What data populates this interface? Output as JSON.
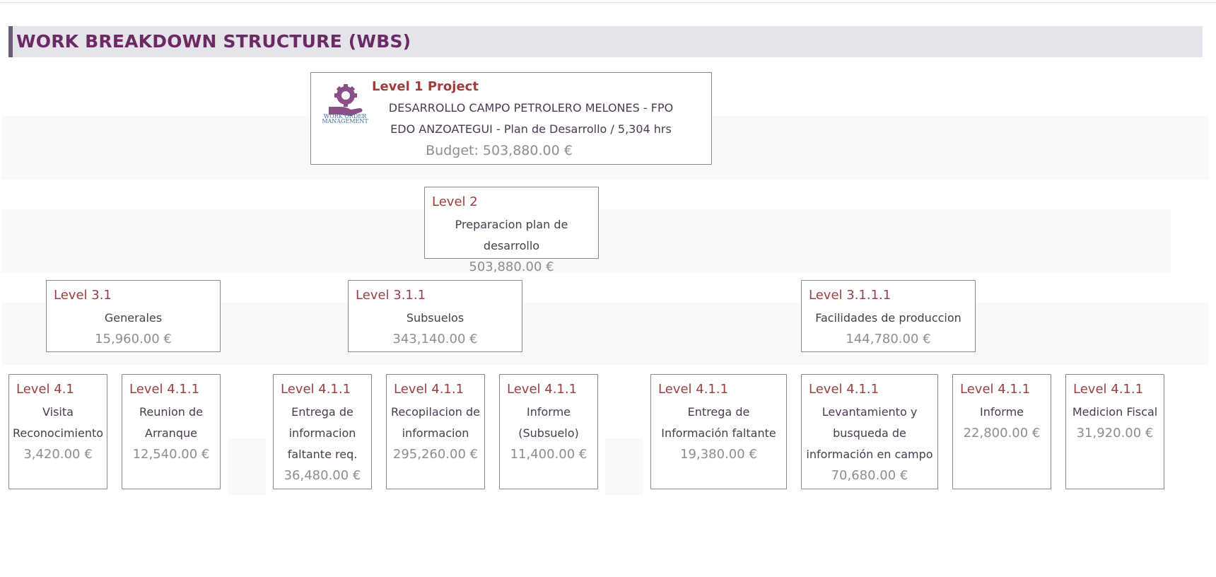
{
  "page": {
    "title": "WORK BREAKDOWN STRUCTURE (WBS)"
  },
  "logo": {
    "line1": "WORK ORDER",
    "line2": "MANAGEMENT",
    "icon": "hand-gear-icon"
  },
  "colors": {
    "level_label": "#9a4040",
    "title": "#6b2a63",
    "value": "#8e8e8e",
    "header_bg": "#e4e4ea"
  },
  "root": {
    "level": "Level 1 Project",
    "name": "DESARROLLO CAMPO PETROLERO MELONES - FPO EDO ANZOATEGUI - Plan de Desarrollo / 5,304 hrs",
    "budget": "Budget: 503,880.00 €"
  },
  "level2": {
    "level": "Level 2",
    "name": "Preparacion plan de desarrollo",
    "value": "503,880.00 €"
  },
  "level3": [
    {
      "level": "Level 3.1",
      "name": "Generales",
      "value": "15,960.00 €"
    },
    {
      "level": "Level 3.1.1",
      "name": "Subsuelos",
      "value": "343,140.00 €"
    },
    {
      "level": "Level 3.1.1.1",
      "name": "Facilidades de produccion",
      "value": "144,780.00 €"
    }
  ],
  "level4": [
    {
      "level": "Level 4.1",
      "name": "Visita Reconocimiento",
      "value": "3,420.00 €"
    },
    {
      "level": "Level 4.1.1",
      "name": "Reunion de Arranque",
      "value": "12,540.00 €"
    },
    {
      "level": "Level 4.1.1",
      "name": "Entrega de informacion faltante req.",
      "value": "36,480.00 €"
    },
    {
      "level": "Level 4.1.1",
      "name": "Recopilacion de informacion",
      "value": "295,260.00 €"
    },
    {
      "level": "Level 4.1.1",
      "name": "Informe (Subsuelo)",
      "value": "11,400.00 €"
    },
    {
      "level": "Level 4.1.1",
      "name": "Entrega de Información faltante",
      "value": "19,380.00 €"
    },
    {
      "level": "Level 4.1.1",
      "name": "Levantamiento y busqueda de información en campo",
      "value": "70,680.00 €"
    },
    {
      "level": "Level 4.1.1",
      "name": "Informe",
      "value": "22,800.00 €"
    },
    {
      "level": "Level 4.1.1",
      "name": "Medicion Fiscal",
      "value": "31,920.00 €"
    }
  ]
}
